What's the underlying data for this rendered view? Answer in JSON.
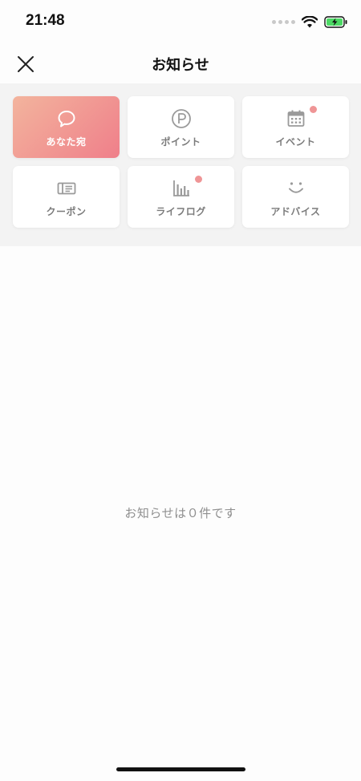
{
  "status_bar": {
    "time": "21:48"
  },
  "header": {
    "title": "お知らせ"
  },
  "categories": [
    {
      "label": "あなた宛",
      "icon": "speech-bubble-icon",
      "active": true,
      "has_badge": false
    },
    {
      "label": "ポイント",
      "icon": "point-icon",
      "active": false,
      "has_badge": false
    },
    {
      "label": "イベント",
      "icon": "calendar-icon",
      "active": false,
      "has_badge": true
    },
    {
      "label": "クーポン",
      "icon": "coupon-icon",
      "active": false,
      "has_badge": false
    },
    {
      "label": "ライフログ",
      "icon": "bar-chart-icon",
      "active": false,
      "has_badge": true
    },
    {
      "label": "アドバイス",
      "icon": "smile-icon",
      "active": false,
      "has_badge": false
    }
  ],
  "empty_state": {
    "message": "お知らせは０件です"
  },
  "colors": {
    "active_gradient_start": "#f3b49d",
    "active_gradient_end": "#ef7f8a",
    "badge": "#ef9596",
    "icon_gray": "#9a9a9a"
  }
}
